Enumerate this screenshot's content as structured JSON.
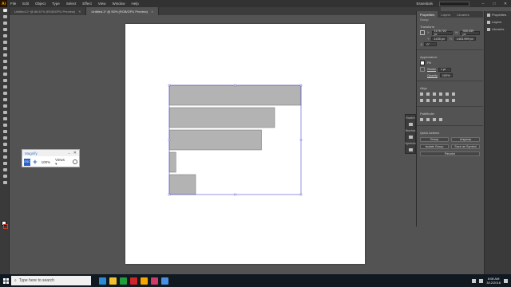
{
  "app": {
    "logo": "Ai"
  },
  "menu": [
    "File",
    "Edit",
    "Object",
    "Type",
    "Select",
    "Effect",
    "View",
    "Window",
    "Help"
  ],
  "workspace": "Essentials",
  "doc_tabs": [
    {
      "label": "Untitled-1* @ 66.67% (RGB/GPU Preview)",
      "active": false
    },
    {
      "label": "Untitled-1* @ 50% (RGB/GPU Preview)",
      "active": true
    }
  ],
  "magnify": {
    "title": "Magnify",
    "button": "ESC",
    "zoom": "100%",
    "view": "Views ▾"
  },
  "mini_panel": [
    "Swatch",
    "Brushes",
    "Symbols"
  ],
  "properties": {
    "tabs": [
      "Properties",
      "Layers",
      "Libraries"
    ],
    "group_label": "Group",
    "transform_label": "Transform",
    "x": "1178.722 px",
    "y": "1435 px",
    "w": "355.339 px",
    "h": "1403.999 px",
    "angle": "0°",
    "appearance_label": "Appearance",
    "fill_label": "Fill",
    "stroke_label": "Stroke",
    "stroke_value": "1 pt",
    "opacity_label": "Opacity",
    "opacity_value": "100%",
    "align_label": "Align",
    "pathfinder_label": "Pathfinder",
    "quick_actions_label": "Quick Actions",
    "qa": {
      "group": "Group",
      "ungroup": "Ungroup",
      "isolate": "Isolate Group",
      "save_symbol": "Save as Symbol",
      "recolor": "Recolor"
    }
  },
  "dock": [
    "Properties",
    "Layers",
    "Libraries"
  ],
  "taskbar": {
    "search_placeholder": "Type here to search",
    "time": "8:08 AM",
    "date": "3/12/2018",
    "app_colors": [
      "#2b8ad6",
      "#f2c12e",
      "#1f9e3b",
      "#d0242a",
      "#f7a600",
      "#cc3b6a",
      "#4a90e2"
    ]
  },
  "colors": {
    "bar_fill": "#b3b3b3",
    "bar_stroke": "#6c6c6c",
    "selection": "#4b4bd6"
  },
  "chart_data": {
    "type": "bar",
    "orientation": "horizontal",
    "categories": [
      "",
      "",
      "",
      "",
      ""
    ],
    "values": [
      100,
      80,
      70,
      5,
      20
    ],
    "xlim": [
      0,
      100
    ],
    "grid": false
  }
}
